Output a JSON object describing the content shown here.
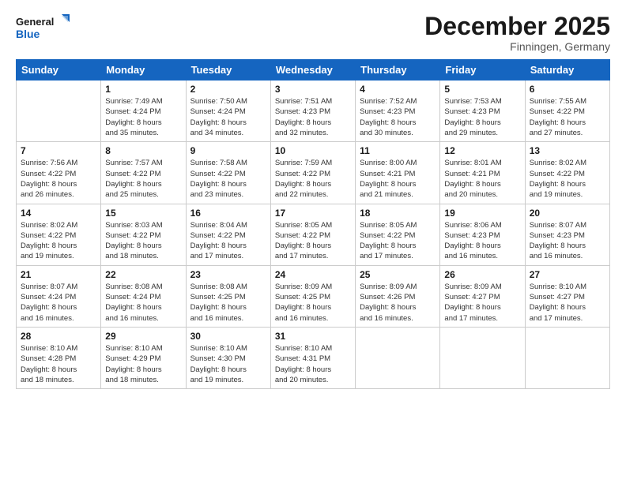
{
  "header": {
    "logo_line1": "General",
    "logo_line2": "Blue",
    "month": "December 2025",
    "location": "Finningen, Germany"
  },
  "days_of_week": [
    "Sunday",
    "Monday",
    "Tuesday",
    "Wednesday",
    "Thursday",
    "Friday",
    "Saturday"
  ],
  "weeks": [
    [
      {
        "day": "",
        "content": ""
      },
      {
        "day": "1",
        "content": "Sunrise: 7:49 AM\nSunset: 4:24 PM\nDaylight: 8 hours\nand 35 minutes."
      },
      {
        "day": "2",
        "content": "Sunrise: 7:50 AM\nSunset: 4:24 PM\nDaylight: 8 hours\nand 34 minutes."
      },
      {
        "day": "3",
        "content": "Sunrise: 7:51 AM\nSunset: 4:23 PM\nDaylight: 8 hours\nand 32 minutes."
      },
      {
        "day": "4",
        "content": "Sunrise: 7:52 AM\nSunset: 4:23 PM\nDaylight: 8 hours\nand 30 minutes."
      },
      {
        "day": "5",
        "content": "Sunrise: 7:53 AM\nSunset: 4:23 PM\nDaylight: 8 hours\nand 29 minutes."
      },
      {
        "day": "6",
        "content": "Sunrise: 7:55 AM\nSunset: 4:22 PM\nDaylight: 8 hours\nand 27 minutes."
      }
    ],
    [
      {
        "day": "7",
        "content": "Sunrise: 7:56 AM\nSunset: 4:22 PM\nDaylight: 8 hours\nand 26 minutes."
      },
      {
        "day": "8",
        "content": "Sunrise: 7:57 AM\nSunset: 4:22 PM\nDaylight: 8 hours\nand 25 minutes."
      },
      {
        "day": "9",
        "content": "Sunrise: 7:58 AM\nSunset: 4:22 PM\nDaylight: 8 hours\nand 23 minutes."
      },
      {
        "day": "10",
        "content": "Sunrise: 7:59 AM\nSunset: 4:22 PM\nDaylight: 8 hours\nand 22 minutes."
      },
      {
        "day": "11",
        "content": "Sunrise: 8:00 AM\nSunset: 4:21 PM\nDaylight: 8 hours\nand 21 minutes."
      },
      {
        "day": "12",
        "content": "Sunrise: 8:01 AM\nSunset: 4:21 PM\nDaylight: 8 hours\nand 20 minutes."
      },
      {
        "day": "13",
        "content": "Sunrise: 8:02 AM\nSunset: 4:22 PM\nDaylight: 8 hours\nand 19 minutes."
      }
    ],
    [
      {
        "day": "14",
        "content": "Sunrise: 8:02 AM\nSunset: 4:22 PM\nDaylight: 8 hours\nand 19 minutes."
      },
      {
        "day": "15",
        "content": "Sunrise: 8:03 AM\nSunset: 4:22 PM\nDaylight: 8 hours\nand 18 minutes."
      },
      {
        "day": "16",
        "content": "Sunrise: 8:04 AM\nSunset: 4:22 PM\nDaylight: 8 hours\nand 17 minutes."
      },
      {
        "day": "17",
        "content": "Sunrise: 8:05 AM\nSunset: 4:22 PM\nDaylight: 8 hours\nand 17 minutes."
      },
      {
        "day": "18",
        "content": "Sunrise: 8:05 AM\nSunset: 4:22 PM\nDaylight: 8 hours\nand 17 minutes."
      },
      {
        "day": "19",
        "content": "Sunrise: 8:06 AM\nSunset: 4:23 PM\nDaylight: 8 hours\nand 16 minutes."
      },
      {
        "day": "20",
        "content": "Sunrise: 8:07 AM\nSunset: 4:23 PM\nDaylight: 8 hours\nand 16 minutes."
      }
    ],
    [
      {
        "day": "21",
        "content": "Sunrise: 8:07 AM\nSunset: 4:24 PM\nDaylight: 8 hours\nand 16 minutes."
      },
      {
        "day": "22",
        "content": "Sunrise: 8:08 AM\nSunset: 4:24 PM\nDaylight: 8 hours\nand 16 minutes."
      },
      {
        "day": "23",
        "content": "Sunrise: 8:08 AM\nSunset: 4:25 PM\nDaylight: 8 hours\nand 16 minutes."
      },
      {
        "day": "24",
        "content": "Sunrise: 8:09 AM\nSunset: 4:25 PM\nDaylight: 8 hours\nand 16 minutes."
      },
      {
        "day": "25",
        "content": "Sunrise: 8:09 AM\nSunset: 4:26 PM\nDaylight: 8 hours\nand 16 minutes."
      },
      {
        "day": "26",
        "content": "Sunrise: 8:09 AM\nSunset: 4:27 PM\nDaylight: 8 hours\nand 17 minutes."
      },
      {
        "day": "27",
        "content": "Sunrise: 8:10 AM\nSunset: 4:27 PM\nDaylight: 8 hours\nand 17 minutes."
      }
    ],
    [
      {
        "day": "28",
        "content": "Sunrise: 8:10 AM\nSunset: 4:28 PM\nDaylight: 8 hours\nand 18 minutes."
      },
      {
        "day": "29",
        "content": "Sunrise: 8:10 AM\nSunset: 4:29 PM\nDaylight: 8 hours\nand 18 minutes."
      },
      {
        "day": "30",
        "content": "Sunrise: 8:10 AM\nSunset: 4:30 PM\nDaylight: 8 hours\nand 19 minutes."
      },
      {
        "day": "31",
        "content": "Sunrise: 8:10 AM\nSunset: 4:31 PM\nDaylight: 8 hours\nand 20 minutes."
      },
      {
        "day": "",
        "content": ""
      },
      {
        "day": "",
        "content": ""
      },
      {
        "day": "",
        "content": ""
      }
    ]
  ]
}
